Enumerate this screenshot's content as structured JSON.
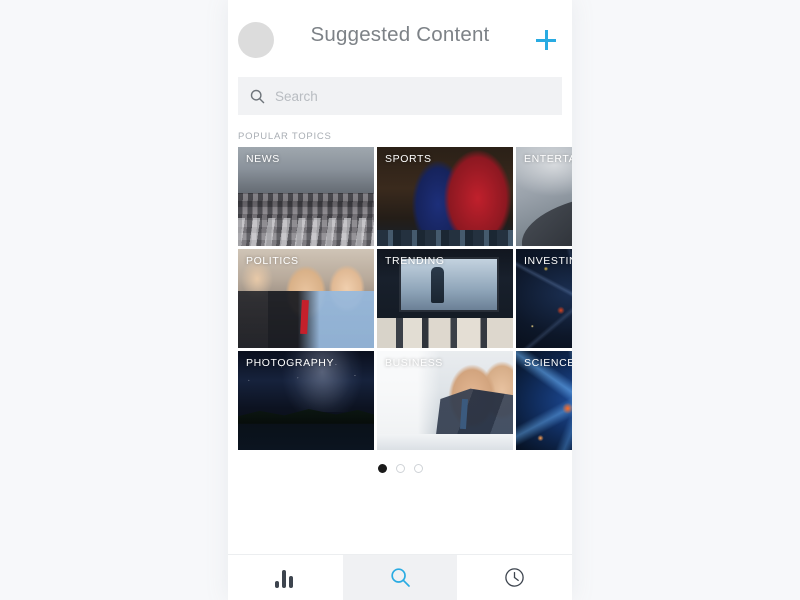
{
  "header": {
    "title": "Suggested Content",
    "avatar_name": "user-avatar",
    "add_icon": "plus-icon"
  },
  "search": {
    "placeholder": "Search",
    "value": "",
    "icon": "search-icon"
  },
  "section": {
    "label": "POPULAR TOPICS"
  },
  "topics": [
    {
      "label": "NEWS",
      "art": "art-news"
    },
    {
      "label": "SPORTS",
      "art": "art-sports"
    },
    {
      "label": "ENTERTAINMENT",
      "art": "art-entertainment"
    },
    {
      "label": "POLITICS",
      "art": "art-politics"
    },
    {
      "label": "TRENDING",
      "art": "art-trending"
    },
    {
      "label": "INVESTING",
      "art": "art-investing"
    },
    {
      "label": "PHOTOGRAPHY",
      "art": "art-photography"
    },
    {
      "label": "BUSINESS",
      "art": "art-business"
    },
    {
      "label": "SCIENCE",
      "art": "art-science"
    }
  ],
  "pager": {
    "total": 3,
    "active_index": 0
  },
  "bottom_nav": {
    "items": [
      {
        "icon": "bar-chart-icon",
        "active": false
      },
      {
        "icon": "search-icon",
        "active": true
      },
      {
        "icon": "clock-icon",
        "active": false
      }
    ]
  },
  "colors": {
    "accent": "#29ABE2",
    "page_background": "#f7f8fa",
    "surface": "#ffffff",
    "search_field": "#f1f2f4",
    "title_text": "#7d8287",
    "muted_text": "#a9aeb4",
    "icon_dark": "#3d444e",
    "avatar": "#dcdcdc"
  }
}
